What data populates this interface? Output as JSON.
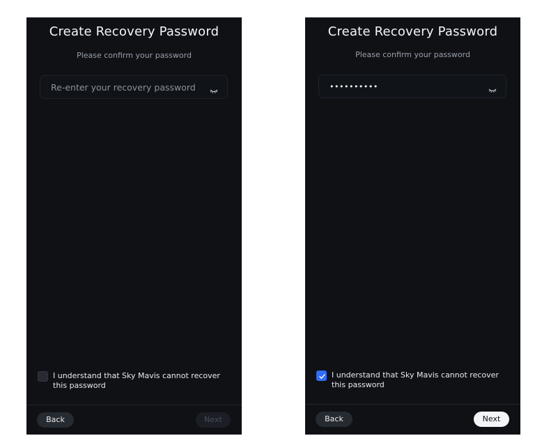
{
  "left_screen": {
    "title": "Create Recovery Password",
    "subtitle": "Please confirm your password",
    "password_input": {
      "placeholder": "Re-enter your recovery password",
      "value": "",
      "icon": "eye-closed-icon"
    },
    "acknowledge_checkbox": {
      "checked": false,
      "label": "I understand that Sky Mavis cannot recover this password"
    },
    "back_label": "Back",
    "next_label": "Next",
    "next_enabled": false
  },
  "right_screen": {
    "title": "Create Recovery Password",
    "subtitle": "Please confirm your password",
    "password_input": {
      "placeholder": "Re-enter your recovery password",
      "value": "••••••••••",
      "icon": "eye-closed-icon"
    },
    "acknowledge_checkbox": {
      "checked": true,
      "label": "I understand that Sky Mavis cannot recover this password"
    },
    "back_label": "Back",
    "next_label": "Next",
    "next_enabled": true
  },
  "colors": {
    "screen_background": "#0f1115",
    "checkbox_checked": "#2f6df6",
    "next_enabled_background": "#f4f5f7"
  }
}
